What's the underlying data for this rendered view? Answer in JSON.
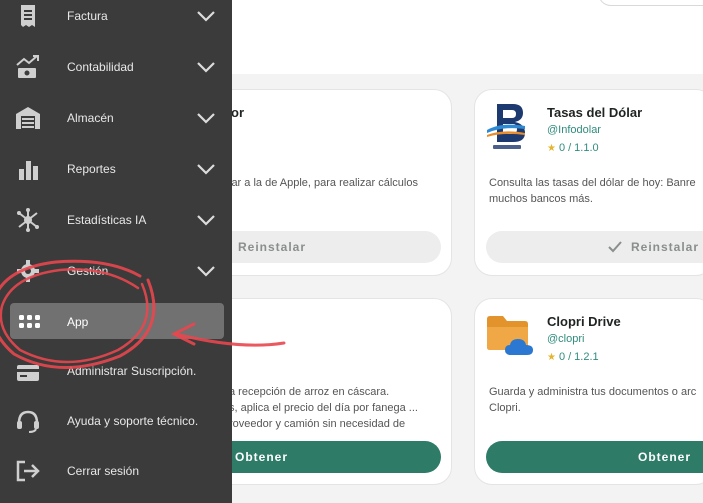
{
  "sidebar": {
    "items": [
      {
        "label": "Factura",
        "icon": "receipt-icon",
        "has_chevron": true
      },
      {
        "label": "Contabilidad",
        "icon": "money-chart-icon",
        "has_chevron": true
      },
      {
        "label": "Almacén",
        "icon": "warehouse-icon",
        "has_chevron": true
      },
      {
        "label": "Reportes",
        "icon": "bar-chart-icon",
        "has_chevron": true
      },
      {
        "label": "Estadísticas IA",
        "icon": "ai-network-icon",
        "has_chevron": true
      },
      {
        "label": "Gestión",
        "icon": "gear-icon",
        "has_chevron": true
      },
      {
        "label": "App",
        "icon": "grid-dots-icon",
        "has_chevron": false,
        "active": true
      },
      {
        "label": "Administrar Suscripción.",
        "icon": "subscription-icon",
        "has_chevron": false
      },
      {
        "label": "Ayuda y soporte técnico.",
        "icon": "headset-icon",
        "has_chevron": false
      },
      {
        "label": "Cerrar sesión",
        "icon": "logout-icon",
        "has_chevron": false
      }
    ]
  },
  "cards": [
    {
      "title": "or",
      "desc": [
        "lar a la de Apple, para realizar cálculos"
      ],
      "button": "Reinstalar"
    },
    {
      "title": "Tasas del Dólar",
      "handle": "@Infodolar",
      "rating": "0",
      "version": "1.1.0",
      "icon": "infodolar-logo",
      "desc": [
        "Consulta las tasas del dólar de hoy: Banre",
        "muchos bancos más."
      ],
      "button": "Reinstalar"
    },
    {
      "title": "",
      "desc": [
        "a recepción de arroz en cáscara.",
        "s, aplica el precio del día por fanega ...",
        "roveedor y camión sin necesidad de"
      ],
      "button": "Obtener"
    },
    {
      "title": "Clopri Drive",
      "handle": "@clopri",
      "rating": "0",
      "version": "1.2.1",
      "icon": "folder-cloud-icon",
      "desc": [
        "Guarda y administra tus documentos o arc",
        "Clopri."
      ],
      "button": "Obtener"
    }
  ],
  "colors": {
    "sidebar_bg": "#3a3b3a",
    "active_item": "#707170",
    "accent_green": "#2e7b68",
    "annotation_red": "#e8474f"
  }
}
